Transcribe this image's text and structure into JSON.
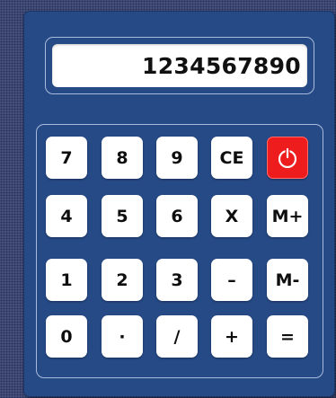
{
  "display": {
    "value": "1234567890"
  },
  "keys": [
    {
      "label": "7",
      "name": "key-7"
    },
    {
      "label": "8",
      "name": "key-8"
    },
    {
      "label": "9",
      "name": "key-9"
    },
    {
      "label": "CE",
      "name": "clear-entry-button"
    },
    {
      "label": "",
      "name": "power-button",
      "icon": "power-icon"
    },
    {
      "label": "4",
      "name": "key-4"
    },
    {
      "label": "5",
      "name": "key-5"
    },
    {
      "label": "6",
      "name": "key-6"
    },
    {
      "label": "X",
      "name": "multiply-button"
    },
    {
      "label": "M+",
      "name": "memory-add-button"
    },
    {
      "label": "1",
      "name": "key-1"
    },
    {
      "label": "2",
      "name": "key-2"
    },
    {
      "label": "3",
      "name": "key-3"
    },
    {
      "label": "–",
      "name": "subtract-button"
    },
    {
      "label": "M-",
      "name": "memory-subtract-button"
    },
    {
      "label": "0",
      "name": "key-0"
    },
    {
      "label": "·",
      "name": "decimal-point-button"
    },
    {
      "label": "/",
      "name": "divide-button"
    },
    {
      "label": "+",
      "name": "add-button"
    },
    {
      "label": "=",
      "name": "equals-button"
    }
  ],
  "colors": {
    "body": "#264a86",
    "power": "#ee1c1c"
  }
}
